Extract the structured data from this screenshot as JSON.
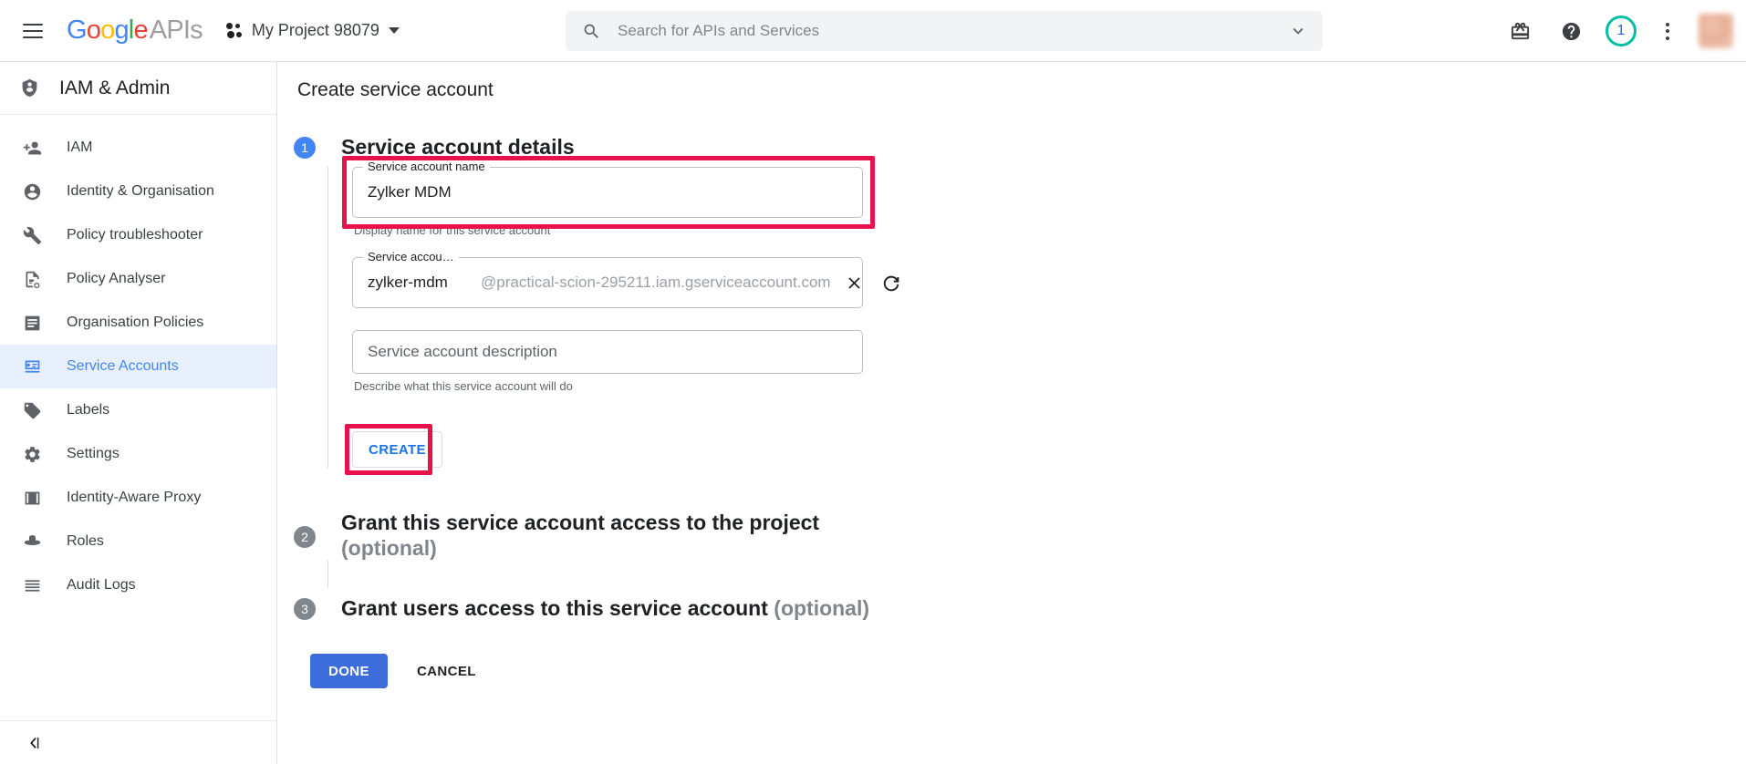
{
  "topbar": {
    "menu_label": "Main menu",
    "logo": {
      "google": "Google",
      "apis": "APIs"
    },
    "project": {
      "name": "My Project 98079"
    },
    "search": {
      "placeholder": "Search for APIs and Services",
      "value": ""
    },
    "icons": {
      "gift": "gift-icon",
      "help": "help-icon",
      "notifications_count": "1",
      "kebab": "more-options-icon",
      "avatar": "account-avatar"
    },
    "colors": {
      "notification_ring": "#00BFA5",
      "notification_text": "#3B5BDB"
    }
  },
  "sidebar": {
    "title": "IAM & Admin",
    "items": [
      {
        "label": "IAM",
        "icon": "person-add-icon",
        "active": false
      },
      {
        "label": "Identity & Organisation",
        "icon": "account-circle-icon",
        "active": false
      },
      {
        "label": "Policy troubleshooter",
        "icon": "wrench-icon",
        "active": false
      },
      {
        "label": "Policy Analyser",
        "icon": "document-search-icon",
        "active": false
      },
      {
        "label": "Organisation Policies",
        "icon": "list-document-icon",
        "active": false
      },
      {
        "label": "Service Accounts",
        "icon": "service-account-key-icon",
        "active": true
      },
      {
        "label": "Labels",
        "icon": "tag-icon",
        "active": false
      },
      {
        "label": "Settings",
        "icon": "gear-icon",
        "active": false
      },
      {
        "label": "Identity-Aware Proxy",
        "icon": "proxy-icon",
        "active": false
      },
      {
        "label": "Roles",
        "icon": "roles-hat-icon",
        "active": false
      },
      {
        "label": "Audit Logs",
        "icon": "audit-logs-icon",
        "active": false
      }
    ],
    "collapse_label": "Collapse navigation"
  },
  "main": {
    "page_title": "Create service account",
    "steps": [
      {
        "number": "1",
        "title": "Service account details",
        "optional": "",
        "state": "active"
      },
      {
        "number": "2",
        "title": "Grant this service account access to the project",
        "optional": "(optional)",
        "state": "inactive"
      },
      {
        "number": "3",
        "title": "Grant users access to this service account",
        "optional": "(optional)",
        "state": "inactive"
      }
    ],
    "form": {
      "name_field": {
        "legend": "Service account name",
        "value": "Zylker MDM",
        "helper": "Display name for this service account",
        "highlighted": true
      },
      "id_field": {
        "legend": "Service accou…",
        "value": "zylker-mdm",
        "suffix": "@practical-scion-295211.iam.gserviceaccount.com",
        "clear_icon": "close-icon",
        "refresh_icon": "refresh-icon"
      },
      "description_field": {
        "placeholder": "Service account description",
        "value": "",
        "helper": "Describe what this service account will do"
      },
      "create_button": {
        "label": "CREATE",
        "highlighted": true
      }
    },
    "footer": {
      "done_label": "DONE",
      "cancel_label": "CANCEL"
    }
  },
  "annotation": {
    "highlight_color": "#E8114B"
  }
}
